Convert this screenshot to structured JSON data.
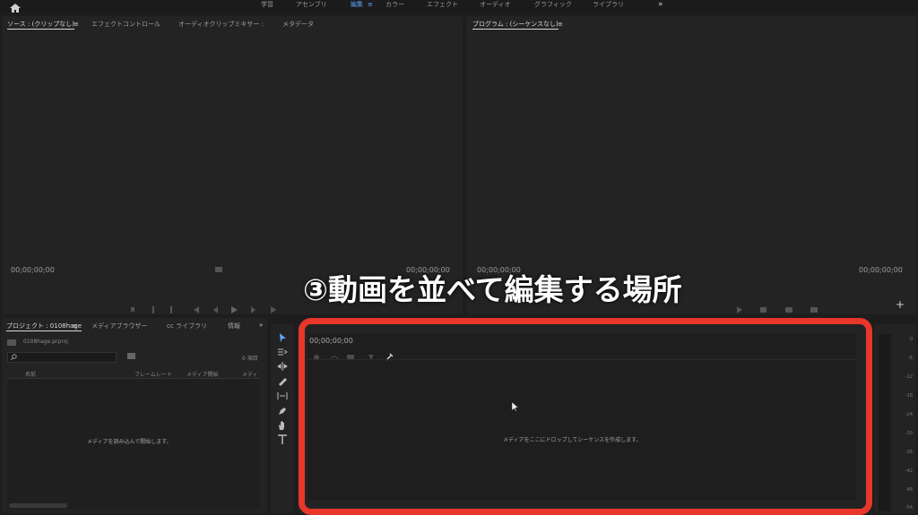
{
  "workspaces": [
    {
      "label": "学習",
      "active": false
    },
    {
      "label": "アセンブリ",
      "active": false
    },
    {
      "label": "編集",
      "active": true
    },
    {
      "label": "カラー",
      "active": false
    },
    {
      "label": "エフェクト",
      "active": false
    },
    {
      "label": "オーディオ",
      "active": false
    },
    {
      "label": "グラフィック",
      "active": false
    },
    {
      "label": "ライブラリ",
      "active": false
    }
  ],
  "overflow_glyph": "»",
  "source_panel": {
    "tabs": [
      "ソース : (クリップなし)",
      "エフェクトコントロール",
      "オーディオクリップミキサー :",
      "メタデータ"
    ],
    "menu_glyph": "≡",
    "timecode_left": "00;00;00;00",
    "timecode_right": "00;00;00;00"
  },
  "program_panel": {
    "title": "プログラム : (シーケンスなし)",
    "menu_glyph": "≡",
    "timecode_left": "00;00;00;00",
    "timecode_right": "00;00;00;00",
    "add_glyph": "+"
  },
  "project_panel": {
    "tabs": [
      "プロジェクト : 0108hage",
      "メディアブラウザー",
      "ライブラリ",
      "情報"
    ],
    "cc_prefix": "cc",
    "file_name": "0108hage.prproj",
    "item_count": "0 項目",
    "columns": [
      "名前",
      "フレームレート",
      "メディア開始",
      "メディ"
    ],
    "empty_message": "メディアを読み込んで開始します。"
  },
  "timeline_panel": {
    "timecode": "00;00;00;00",
    "drop_message": "メディアをここにドロップしてシーケンスを作成します。"
  },
  "audio_meter_labels": [
    "0",
    "-6",
    "-12",
    "-18",
    "-24",
    "-30",
    "-36",
    "-42",
    "-48",
    "-54"
  ],
  "annotation": "③動画を並べて編集する場所",
  "colors": {
    "accent": "#5fa8ff",
    "highlight": "#e8362a",
    "panel": "#232323",
    "background": "#1d1d1d"
  }
}
